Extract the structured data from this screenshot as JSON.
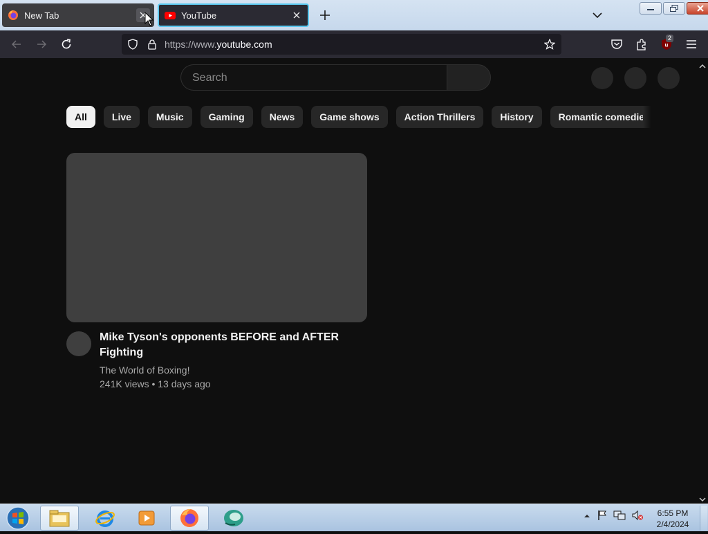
{
  "tabs": [
    {
      "title": "New Tab",
      "favicon": "firefox-icon"
    },
    {
      "title": "YouTube",
      "favicon": "youtube-icon"
    }
  ],
  "address_bar": {
    "url_scheme": "https://www.",
    "url_host": "youtube.com"
  },
  "extension_badge": "2",
  "youtube": {
    "search_placeholder": "Search",
    "chips": [
      "All",
      "Live",
      "Music",
      "Gaming",
      "News",
      "Game shows",
      "Action Thrillers",
      "History",
      "Romantic comedies"
    ],
    "active_chip": "All",
    "video": {
      "title": "Mike Tyson's opponents BEFORE and AFTER Fighting",
      "channel": "The World of Boxing!",
      "meta": "241K views • 13 days ago"
    }
  },
  "taskbar": {
    "time": "6:55 PM",
    "date": "2/4/2024",
    "apps": [
      "file-explorer-icon",
      "internet-explorer-icon",
      "media-player-icon",
      "firefox-icon",
      "network-app-icon"
    ]
  },
  "colors": {
    "accent": "#5ac8f0",
    "page_bg": "#0f0f0f",
    "chip_bg": "#272727",
    "toolbar_bg": "#2b2a33"
  }
}
